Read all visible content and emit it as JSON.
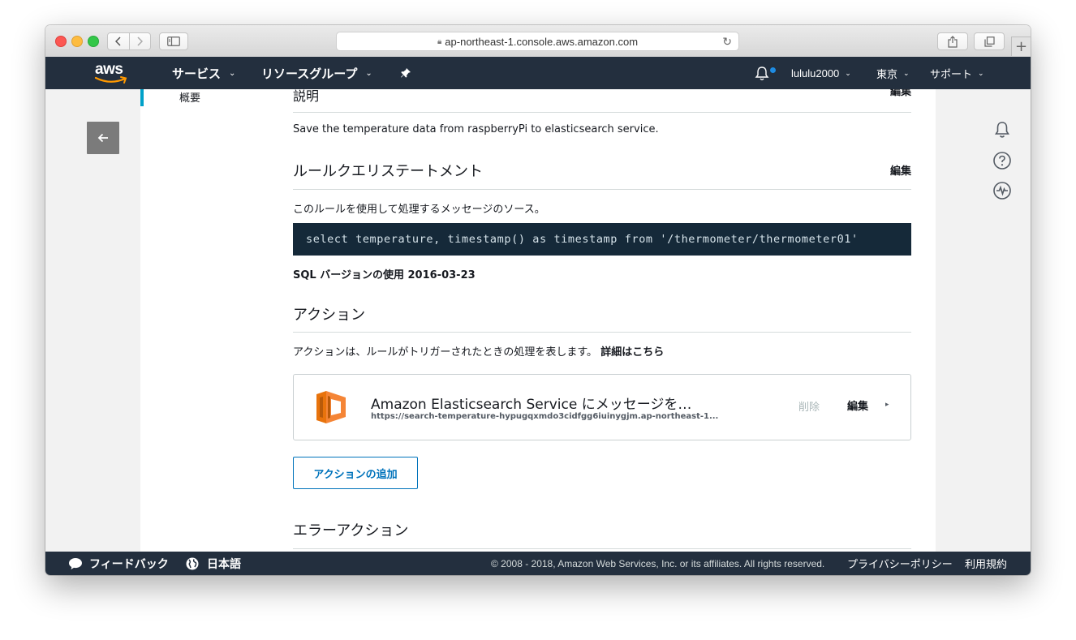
{
  "browser": {
    "url": "ap-northeast-1.console.aws.amazon.com",
    "new_tab": "+"
  },
  "nav": {
    "logo": "aws",
    "services": "サービス",
    "resource_groups": "リソースグループ",
    "user": "lululu2000",
    "region": "東京",
    "support": "サポート"
  },
  "leftnav": {
    "overview": "概要"
  },
  "description": {
    "title": "説明",
    "edit": "編集",
    "text": "Save the temperature data from raspberryPi to elasticsearch service."
  },
  "query": {
    "title": "ルールクエリステートメント",
    "edit": "編集",
    "desc": "このルールを使用して処理するメッセージのソース。",
    "sql": "select temperature, timestamp() as timestamp from '/thermometer/thermometer01'",
    "version_label": "SQL バージョンの使用",
    "version": "2016-03-23"
  },
  "actions": {
    "title": "アクション",
    "desc": "アクションは、ルールがトリガーされたときの処理を表します。",
    "details_link": "詳細はこちら",
    "items": [
      {
        "title": "Amazon Elasticsearch Service にメッセージを…",
        "url": "https://search-temperature-hypugqxmdo3cidfgg6iuinygjm.ap-northeast-1...",
        "delete": "削除",
        "edit": "編集",
        "icon": "elasticsearch-icon",
        "icon_color": "#e8730c"
      }
    ],
    "add_button": "アクションの追加"
  },
  "error_actions": {
    "title": "エラーアクション"
  },
  "footer": {
    "feedback": "フィードバック",
    "language": "日本語",
    "copyright": "© 2008 - 2018, Amazon Web Services, Inc. or its affiliates. All rights reserved.",
    "privacy": "プライバシーポリシー",
    "terms": "利用規約"
  },
  "colors": {
    "nav_bg": "#232f3e",
    "code_bg": "#152939",
    "link_blue": "#0073bb",
    "accent": "#00a1c9",
    "notification_dot": "#1e8ce3"
  }
}
